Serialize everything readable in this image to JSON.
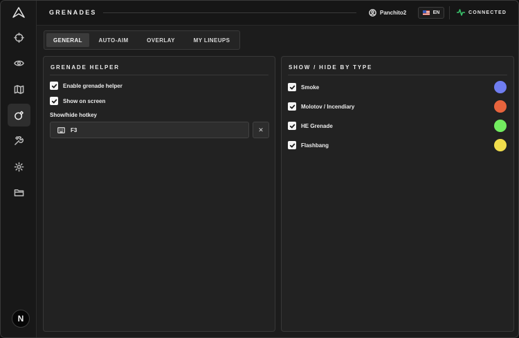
{
  "header": {
    "title": "GRENADES",
    "user": "Panchito2",
    "language": "EN",
    "status": "CONNECTED"
  },
  "sidebar": {
    "items": [
      {
        "icon": "crosshair-icon"
      },
      {
        "icon": "eye-icon"
      },
      {
        "icon": "map-icon"
      },
      {
        "icon": "grenade-icon",
        "active": true
      },
      {
        "icon": "tools-icon"
      },
      {
        "icon": "gear-icon"
      },
      {
        "icon": "folder-icon"
      }
    ],
    "badge": "N"
  },
  "tabs": [
    {
      "label": "GENERAL",
      "active": true
    },
    {
      "label": "AUTO-AIM"
    },
    {
      "label": "OVERLAY"
    },
    {
      "label": "MY LINEUPS"
    }
  ],
  "grenade_helper": {
    "title": "GRENADE HELPER",
    "enable_label": "Enable grenade helper",
    "enable_checked": true,
    "show_label": "Show on screen",
    "show_checked": true,
    "hotkey_label": "Show/hide hotkey",
    "hotkey_value": "F3",
    "clear_label": "✕"
  },
  "show_hide": {
    "title": "SHOW / HIDE BY TYPE",
    "types": [
      {
        "label": "Smoke",
        "checked": true,
        "color": "#6f7df0"
      },
      {
        "label": "Molotov / Incendiary",
        "checked": true,
        "color": "#e8643d"
      },
      {
        "label": "HE Grenade",
        "checked": true,
        "color": "#72ec5f"
      },
      {
        "label": "Flashbang",
        "checked": true,
        "color": "#f1dd4c"
      }
    ]
  }
}
